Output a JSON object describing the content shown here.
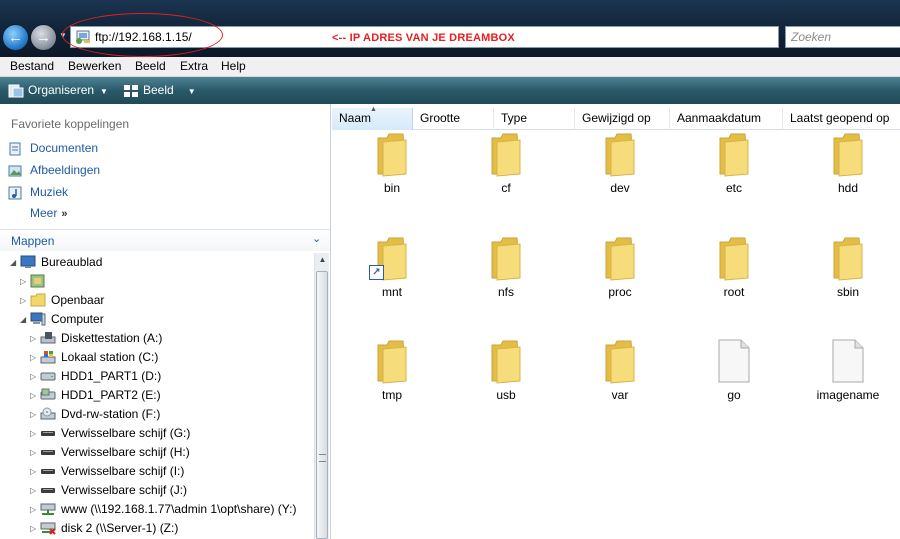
{
  "address": {
    "url": "ftp://192.168.1.15/",
    "annotation": "<-- IP ADRES VAN JE DREAMBOX"
  },
  "search": {
    "placeholder": "Zoeken"
  },
  "menubar": [
    "Bestand",
    "Bewerken",
    "Beeld",
    "Extra",
    "Help"
  ],
  "commandbar": {
    "organize": "Organiseren",
    "view": "Beeld"
  },
  "favorites": {
    "header": "Favoriete koppelingen",
    "links": [
      "Documenten",
      "Afbeeldingen",
      "Muziek"
    ],
    "more": "Meer"
  },
  "folders": {
    "header": "Mappen",
    "tree": [
      {
        "label": "Bureaublad"
      },
      {
        "label": ""
      },
      {
        "label": "Openbaar"
      },
      {
        "label": "Computer"
      },
      {
        "label": "Diskettestation (A:)"
      },
      {
        "label": "Lokaal station (C:)"
      },
      {
        "label": "HDD1_PART1 (D:)"
      },
      {
        "label": "HDD1_PART2 (E:)"
      },
      {
        "label": "Dvd-rw-station (F:)"
      },
      {
        "label": "Verwisselbare schijf (G:)"
      },
      {
        "label": "Verwisselbare schijf (H:)"
      },
      {
        "label": "Verwisselbare schijf (I:)"
      },
      {
        "label": "Verwisselbare schijf (J:)"
      },
      {
        "label": "www (\\\\192.168.1.77\\admin 1\\opt\\share) (Y:)"
      },
      {
        "label": "disk 2 (\\\\Server-1) (Z:)"
      }
    ]
  },
  "columns": [
    "Naam",
    "Grootte",
    "Type",
    "Gewijzigd op",
    "Aanmaakdatum",
    "Laatst geopend op"
  ],
  "items": [
    {
      "name": "bin",
      "kind": "folder"
    },
    {
      "name": "cf",
      "kind": "folder"
    },
    {
      "name": "dev",
      "kind": "folder"
    },
    {
      "name": "etc",
      "kind": "folder"
    },
    {
      "name": "hdd",
      "kind": "folder"
    },
    {
      "name": "mnt",
      "kind": "folder-shortcut"
    },
    {
      "name": "nfs",
      "kind": "folder"
    },
    {
      "name": "proc",
      "kind": "folder"
    },
    {
      "name": "root",
      "kind": "folder"
    },
    {
      "name": "sbin",
      "kind": "folder"
    },
    {
      "name": "tmp",
      "kind": "folder"
    },
    {
      "name": "usb",
      "kind": "folder"
    },
    {
      "name": "var",
      "kind": "folder"
    },
    {
      "name": "go",
      "kind": "file"
    },
    {
      "name": "imagename",
      "kind": "file"
    }
  ],
  "colors": {
    "annotation": "#e5201f",
    "link": "#1e5aa8",
    "folder": "#f2d76a"
  }
}
